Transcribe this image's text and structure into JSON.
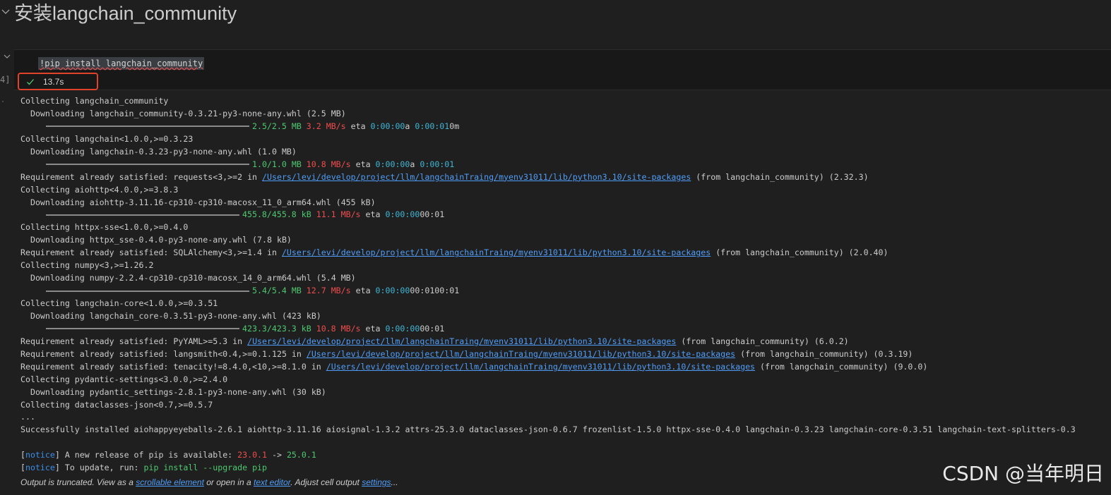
{
  "markdown_title": "安装langchain_community",
  "cell": {
    "execution_count": "4]",
    "code": "!pip install langchain_community",
    "status_time": "13.7s"
  },
  "output_lines": [
    [
      {
        "t": "Collecting langchain_community"
      }
    ],
    [
      {
        "t": "  Downloading langchain_community-0.3.21-py3-none-any.whl (2.5 MB)"
      }
    ],
    [
      {
        "bar": "288px"
      },
      {
        "t": "2.5/2.5 MB",
        "c": "g"
      },
      {
        "t": " "
      },
      {
        "t": "3.2 MB/s",
        "c": "r"
      },
      {
        "t": " eta "
      },
      {
        "t": "0:00:00",
        "c": "c"
      },
      {
        "t": "a "
      },
      {
        "t": "0:00:01",
        "c": "c"
      },
      {
        "t": "0m"
      }
    ],
    [
      {
        "t": "Collecting langchain<1.0.0,>=0.3.23"
      }
    ],
    [
      {
        "t": "  Downloading langchain-0.3.23-py3-none-any.whl (1.0 MB)"
      }
    ],
    [
      {
        "bar": "288px"
      },
      {
        "t": "1.0/1.0 MB",
        "c": "g"
      },
      {
        "t": " "
      },
      {
        "t": "10.8 MB/s",
        "c": "r"
      },
      {
        "t": " eta "
      },
      {
        "t": "0:00:00",
        "c": "c"
      },
      {
        "t": "a "
      },
      {
        "t": "0:00:01",
        "c": "c"
      }
    ],
    [
      {
        "t": "Requirement already satisfied: requests<3,>=2 in "
      },
      {
        "t": "/Users/levi/develop/project/llm/langchainTraing/myenv31011/lib/python3.10/site-packages",
        "c": "lnk"
      },
      {
        "t": " (from langchain_community) (2.32.3)"
      }
    ],
    [
      {
        "t": "Collecting aiohttp<4.0.0,>=3.8.3"
      }
    ],
    [
      {
        "t": "  Downloading aiohttp-3.11.16-cp310-cp310-macosx_11_0_arm64.whl (455 kB)"
      }
    ],
    [
      {
        "bar": "274px"
      },
      {
        "t": "455.8/455.8 kB",
        "c": "g"
      },
      {
        "t": " "
      },
      {
        "t": "11.1 MB/s",
        "c": "r"
      },
      {
        "t": " eta "
      },
      {
        "t": "0:00:00",
        "c": "c"
      },
      {
        "t": "00:01"
      }
    ],
    [
      {
        "t": "Collecting httpx-sse<1.0.0,>=0.4.0"
      }
    ],
    [
      {
        "t": "  Downloading httpx_sse-0.4.0-py3-none-any.whl (7.8 kB)"
      }
    ],
    [
      {
        "t": "Requirement already satisfied: SQLAlchemy<3,>=1.4 in "
      },
      {
        "t": "/Users/levi/develop/project/llm/langchainTraing/myenv31011/lib/python3.10/site-packages",
        "c": "lnk"
      },
      {
        "t": " (from langchain_community) (2.0.40)"
      }
    ],
    [
      {
        "t": "Collecting numpy<3,>=1.26.2"
      }
    ],
    [
      {
        "t": "  Downloading numpy-2.2.4-cp310-cp310-macosx_14_0_arm64.whl (5.4 MB)"
      }
    ],
    [
      {
        "bar": "288px"
      },
      {
        "t": "5.4/5.4 MB",
        "c": "g"
      },
      {
        "t": " "
      },
      {
        "t": "12.7 MB/s",
        "c": "r"
      },
      {
        "t": " eta "
      },
      {
        "t": "0:00:00",
        "c": "c"
      },
      {
        "t": "00:0100:01"
      }
    ],
    [
      {
        "t": "Collecting langchain-core<1.0.0,>=0.3.51"
      }
    ],
    [
      {
        "t": "  Downloading langchain_core-0.3.51-py3-none-any.whl (423 kB)"
      }
    ],
    [
      {
        "bar": "274px"
      },
      {
        "t": "423.3/423.3 kB",
        "c": "g"
      },
      {
        "t": " "
      },
      {
        "t": "10.8 MB/s",
        "c": "r"
      },
      {
        "t": " eta "
      },
      {
        "t": "0:00:00",
        "c": "c"
      },
      {
        "t": "00:01"
      }
    ],
    [
      {
        "t": "Requirement already satisfied: PyYAML>=5.3 in "
      },
      {
        "t": "/Users/levi/develop/project/llm/langchainTraing/myenv31011/lib/python3.10/site-packages",
        "c": "lnk"
      },
      {
        "t": " (from langchain_community) (6.0.2)"
      }
    ],
    [
      {
        "t": "Requirement already satisfied: langsmith<0.4,>=0.1.125 in "
      },
      {
        "t": "/Users/levi/develop/project/llm/langchainTraing/myenv31011/lib/python3.10/site-packages",
        "c": "lnk"
      },
      {
        "t": " (from langchain_community) (0.3.19)"
      }
    ],
    [
      {
        "t": "Requirement already satisfied: tenacity!=8.4.0,<10,>=8.1.0 in "
      },
      {
        "t": "/Users/levi/develop/project/llm/langchainTraing/myenv31011/lib/python3.10/site-packages",
        "c": "lnk"
      },
      {
        "t": " (from langchain_community) (9.0.0)"
      }
    ],
    [
      {
        "t": "Collecting pydantic-settings<3.0.0,>=2.4.0"
      }
    ],
    [
      {
        "t": "  Downloading pydantic_settings-2.8.1-py3-none-any.whl (30 kB)"
      }
    ],
    [
      {
        "t": "Collecting dataclasses-json<0.7,>=0.5.7"
      }
    ],
    [
      {
        "t": "..."
      }
    ],
    [
      {
        "t": "Successfully installed aiohappyeyeballs-2.6.1 aiohttp-3.11.16 aiosignal-1.3.2 attrs-25.3.0 dataclasses-json-0.6.7 frozenlist-1.5.0 httpx-sse-0.4.0 langchain-0.3.23 langchain-core-0.3.51 langchain-text-splitters-0.3"
      }
    ],
    [
      {
        "t": ""
      }
    ],
    [
      {
        "t": "["
      },
      {
        "t": "notice",
        "c": "b"
      },
      {
        "t": "] A new release of pip is available: "
      },
      {
        "t": "23.0.1",
        "c": "r"
      },
      {
        "t": " -> "
      },
      {
        "t": "25.0.1",
        "c": "g"
      }
    ],
    [
      {
        "t": "["
      },
      {
        "t": "notice",
        "c": "b"
      },
      {
        "t": "] To update, run: "
      },
      {
        "t": "pip install --upgrade pip",
        "c": "g"
      }
    ]
  ],
  "footer": {
    "prefix": "Output is truncated. View as a ",
    "link1": "scrollable element",
    "middle": " or open in a ",
    "link2": "text editor",
    "middle2": ". Adjust cell output ",
    "link3": "settings",
    "suffix": "..."
  },
  "watermark": "CSDN @当年明日",
  "colors": {
    "green": "#4ec970",
    "red": "#f14c4c",
    "cyan": "#3fb6d6",
    "link": "#4f9df8",
    "highlight_border": "#e0432a"
  },
  "icons": {
    "collapse": "chevron-down-icon",
    "status": "check-icon"
  }
}
